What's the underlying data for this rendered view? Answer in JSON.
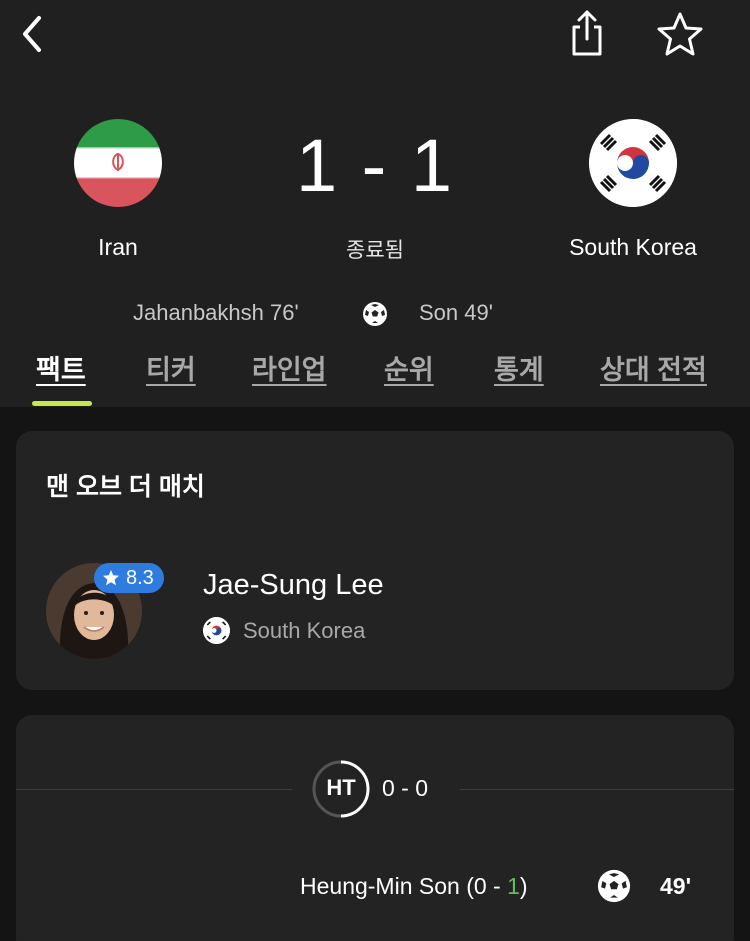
{
  "header": {
    "back_icon": "chevron-left-icon",
    "share_icon": "share-icon",
    "favorite_icon": "star-outline-icon"
  },
  "match": {
    "home_team": "Iran",
    "away_team": "South Korea",
    "score": "1 - 1",
    "status": "종료됨",
    "home_scorer": "Jahanbakhsh  76'",
    "away_scorer": "Son  49'"
  },
  "tabs": [
    {
      "label": "팩트",
      "active": true
    },
    {
      "label": "티커",
      "active": false
    },
    {
      "label": "라인업",
      "active": false
    },
    {
      "label": "순위",
      "active": false
    },
    {
      "label": "통계",
      "active": false
    },
    {
      "label": "상대 전적",
      "active": false
    }
  ],
  "motm": {
    "title": "맨 오브 더 매치",
    "rating": "8.3",
    "player": "Jae-Sung Lee",
    "team": "South Korea"
  },
  "events": {
    "halftime_label": "HT",
    "halftime_score": "0 - 0",
    "goal_player": "Heung-Min Son (0 - ",
    "goal_score_highlight": "1",
    "goal_close": ")",
    "goal_minute": "49'"
  },
  "colors": {
    "background": "#141414",
    "header_bg": "#202020",
    "card_bg": "#232323",
    "accent": "#c7e84a",
    "rating_badge": "#2f7ce0",
    "score_highlight": "#5fbf5a"
  }
}
